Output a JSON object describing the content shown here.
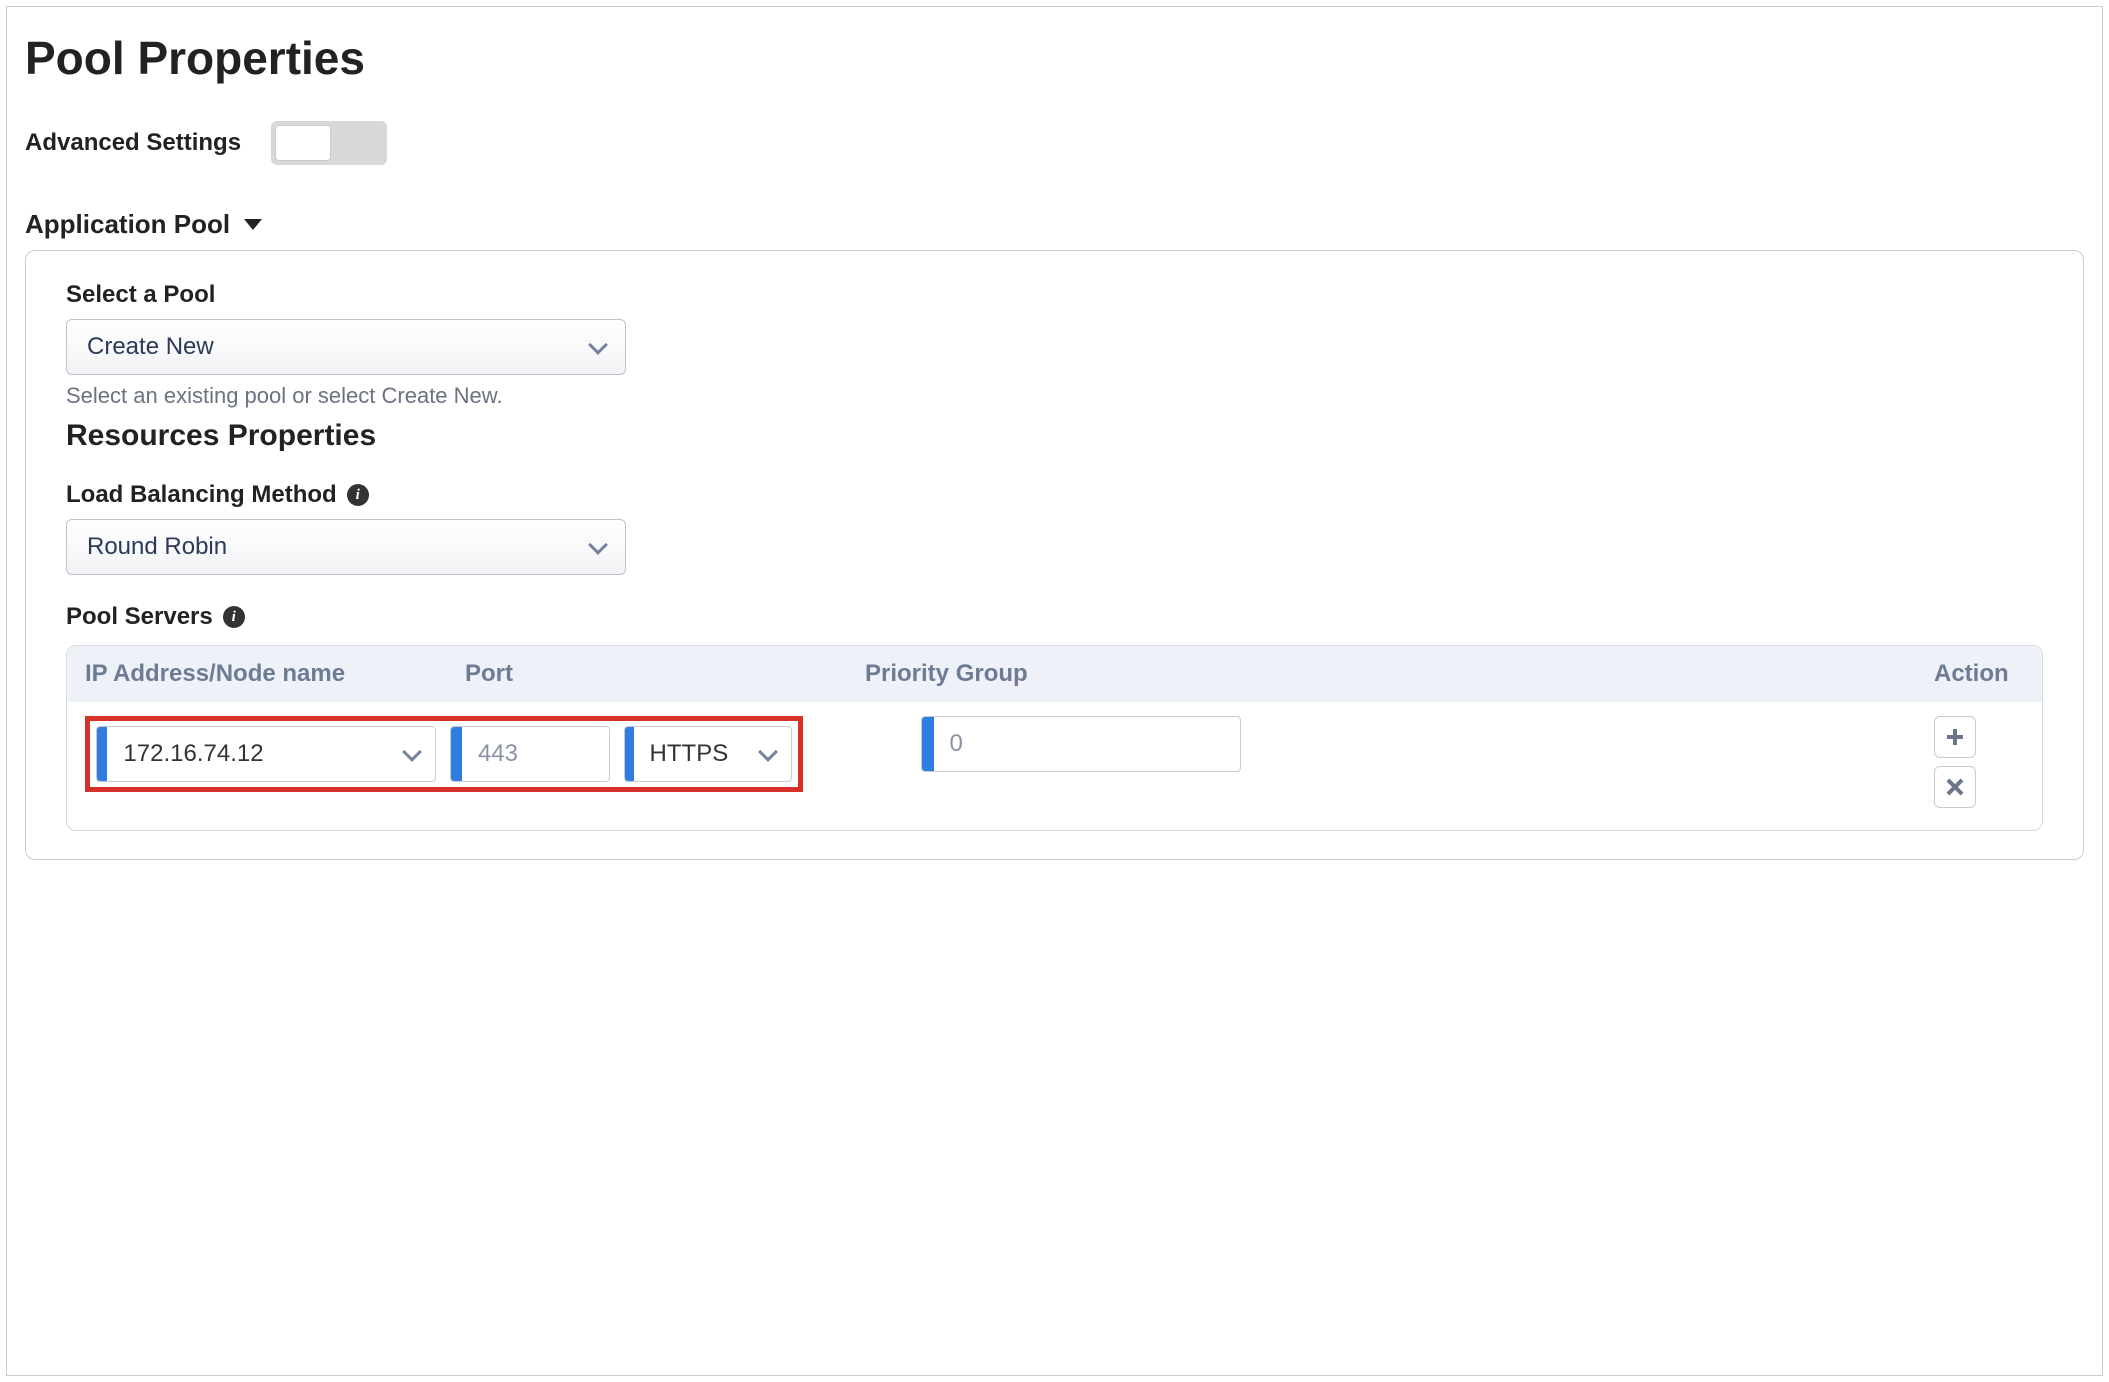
{
  "page_title": "Pool Properties",
  "advanced_settings": {
    "label": "Advanced Settings",
    "enabled": false
  },
  "section": {
    "title": "Application Pool"
  },
  "select_pool": {
    "label": "Select a Pool",
    "value": "Create New",
    "help": "Select an existing pool or select Create New."
  },
  "resources_title": "Resources Properties",
  "load_balancing": {
    "label": "Load Balancing Method",
    "value": "Round Robin"
  },
  "pool_servers": {
    "label": "Pool Servers",
    "columns": {
      "ip": "IP Address/Node name",
      "port": "Port",
      "priority": "Priority Group",
      "action": "Action"
    },
    "rows": [
      {
        "ip": "172.16.74.12",
        "port": "443",
        "protocol": "HTTPS",
        "priority": "0"
      }
    ]
  }
}
